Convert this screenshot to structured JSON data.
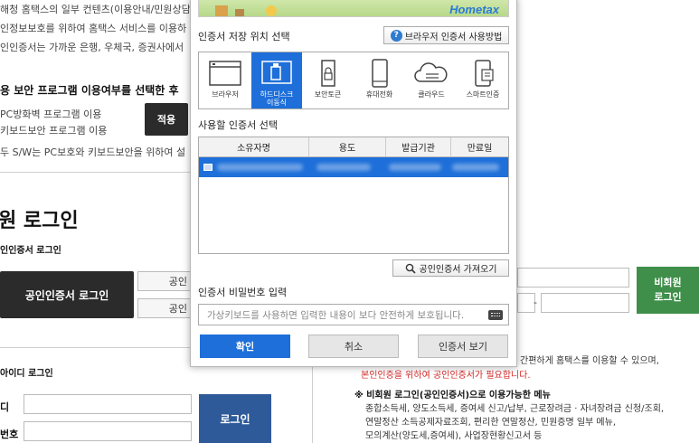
{
  "background": {
    "intro_lines": [
      "해청 홈택스의 일부 컨텐츠(이용안내/민원상담",
      "인정보보호를 위하여 홈택스 서비스를 이용하",
      "인인증서는 가까운 은행, 우체국, 증권사에서 "
    ],
    "security_title": "용 보안 프로그램 이용여부를 선택한 후 ",
    "security_opts": [
      "PC방화벽 프로그램 이용",
      "키보드보안 프로그램 이용"
    ],
    "apply_label": "적용",
    "security_note": "두 S/W는 PC보호와 키보드보안을 위하여 설",
    "login_heading": "원 로그인",
    "cert_login_sub": "인인증서 로그인",
    "cert_login_btn": "공인인증서 로그인",
    "side_btn_1": "공인",
    "side_btn_2": "공인",
    "id_login_sub": "아이디 로그인",
    "id_label": "디",
    "pw_label": "번호",
    "login_btn": "로그인",
    "nonmember_btn_1": "비회원",
    "nonmember_btn_2": "로그인",
    "dash": "-",
    "right_text_1": "간편하게 홈택스를 이용할 수 있으며,",
    "right_text_red": "본인인증을 위하여 공인인증서가 필요합니다.",
    "right_menu_title": "※ 비회원 로그인(공인인증서)으로 이용가능한 메뉴",
    "right_menu_lines": [
      "종합소득세, 양도소득세, 증여세 신고/납부, 근로장려금 · 자녀장려금 신청/조회,",
      "연말정산 소득공제자료조회, 편리한 연말정산, 민원증명 일부 메뉴,",
      "모의계산(양도세,증여세), 사업장현황신고서 등"
    ]
  },
  "dialog": {
    "banner_logo": "Hometax",
    "location_title": "인증서 저장 위치 선택",
    "howto_label": "브라우저 인증서 사용방법",
    "locations": [
      {
        "label": "브라우저",
        "icon": "browser-icon",
        "selected": false
      },
      {
        "label": "하드디스크\n이동식",
        "icon": "usb-drive-icon",
        "selected": true
      },
      {
        "label": "보안토큰",
        "icon": "security-token-icon",
        "selected": false
      },
      {
        "label": "휴대전화",
        "icon": "mobile-phone-icon",
        "selected": false
      },
      {
        "label": "클라우드",
        "icon": "cloud-icon",
        "selected": false
      },
      {
        "label": "스마트인증",
        "icon": "smart-auth-icon",
        "selected": false
      }
    ],
    "cert_select_title": "사용할 인증서 선택",
    "columns": [
      "소유자명",
      "용도",
      "발급기관",
      "만료일"
    ],
    "import_label": "공인인증서 가져오기",
    "password_title": "인증서 비밀번호 입력",
    "password_placeholder": "가상키보드를 사용하면 입력한 내용이 보다 안전하게 보호됩니다.",
    "ok_label": "확인",
    "cancel_label": "취소",
    "view_label": "인증서 보기"
  },
  "colors": {
    "accent": "#1e6fd9",
    "dark_button": "#2b2b2b",
    "login_blue": "#2e5a9a",
    "nonmember_green": "#3f8f4a",
    "warning_red": "#d62a2a"
  }
}
